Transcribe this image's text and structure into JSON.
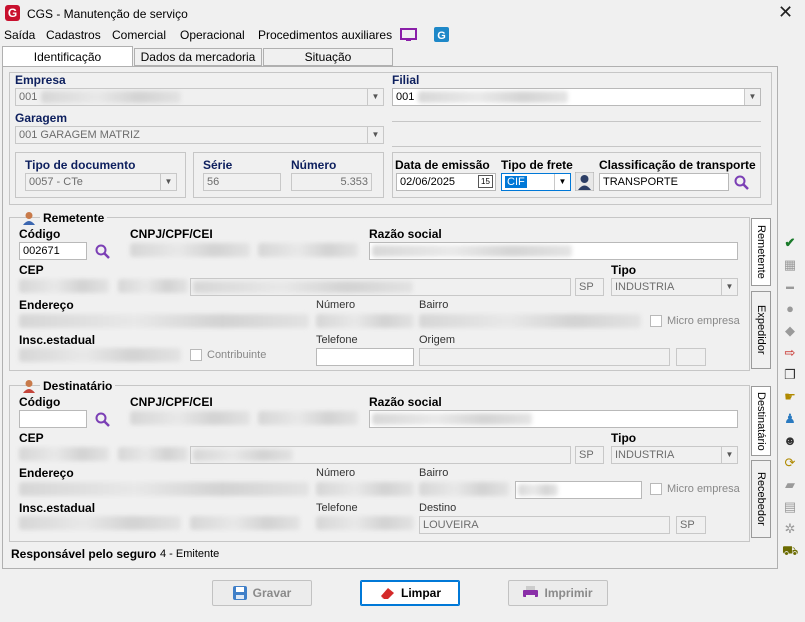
{
  "window": {
    "title": "CGS - Manutenção de serviço",
    "close": "✕"
  },
  "menu": [
    "Saída",
    "Cadastros",
    "Comercial",
    "Operacional",
    "Procedimentos auxiliares"
  ],
  "tabs": [
    "Identificação",
    "Dados da mercadoria",
    "Situação"
  ],
  "empresa": {
    "label": "Empresa",
    "value": "001"
  },
  "filial": {
    "label": "Filial",
    "value": "001"
  },
  "garagem": {
    "label": "Garagem",
    "value": "001 GARAGEM MATRIZ"
  },
  "tipo_documento": {
    "label": "Tipo de documento",
    "value": "0057 - CTe"
  },
  "serie": {
    "label": "Série",
    "value": "56"
  },
  "numero": {
    "label": "Número",
    "value": "5.353"
  },
  "data_emissao": {
    "label": "Data de emissão",
    "value": "02/06/2025",
    "cal": "15"
  },
  "tipo_frete": {
    "label": "Tipo de frete",
    "value": "CIF"
  },
  "classificacao": {
    "label": "Classificação de transporte",
    "value": "TRANSPORTE"
  },
  "remetente": {
    "title": "Remetente",
    "codigo_label": "Código",
    "codigo": "002671",
    "cnpj_label": "CNPJ/CPF/CEI",
    "razao_label": "Razão social",
    "cep_label": "CEP",
    "uf": "SP",
    "tipo_label": "Tipo",
    "tipo": "INDUSTRIA",
    "endereco_label": "Endereço",
    "numero_label": "Número",
    "bairro_label": "Bairro",
    "micro_empresa": "Micro empresa",
    "ie_label": "Insc.estadual",
    "contribuinte": "Contribuinte",
    "telefone_label": "Telefone",
    "origem_label": "Origem",
    "origem": "",
    "origem_uf": ""
  },
  "destinatario": {
    "title": "Destinatário",
    "codigo_label": "Código",
    "cnpj_label": "CNPJ/CPF/CEI",
    "razao_label": "Razão social",
    "cep_label": "CEP",
    "uf": "SP",
    "tipo_label": "Tipo",
    "tipo": "INDUSTRIA",
    "endereco_label": "Endereço",
    "numero_label": "Número",
    "bairro_label": "Bairro",
    "micro_empresa": "Micro empresa",
    "ie_label": "Insc.estadual",
    "telefone_label": "Telefone",
    "destino_label": "Destino",
    "destino": "LOUVEIRA",
    "destino_uf": "SP"
  },
  "side_tabs_top": [
    "Remetente",
    "Expedidor"
  ],
  "side_tabs_bottom": [
    "Destinatário",
    "Recebedor"
  ],
  "seguro": {
    "label": "Responsável pelo seguro",
    "value": "4 - Emitente"
  },
  "buttons": {
    "gravar": "Gravar",
    "limpar": "Limpar",
    "imprimir": "Imprimir"
  },
  "colors": {
    "label_blue": "#0d1f5e",
    "accent": "#0078d7",
    "brand": "#c8102e"
  }
}
